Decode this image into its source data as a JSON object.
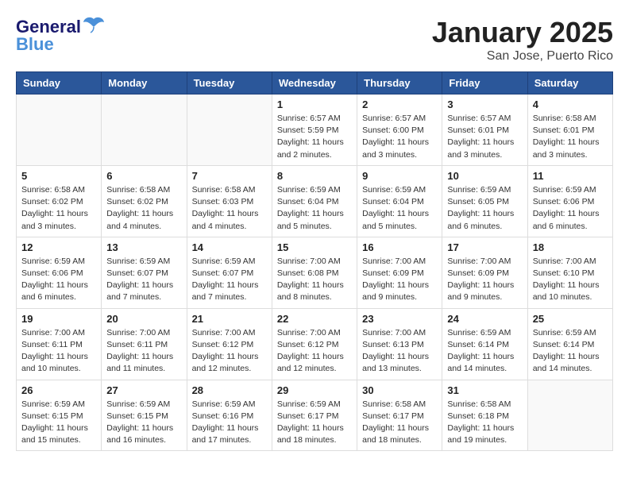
{
  "header": {
    "logo_line1": "General",
    "logo_line2": "Blue",
    "month": "January 2025",
    "location": "San Jose, Puerto Rico"
  },
  "weekdays": [
    "Sunday",
    "Monday",
    "Tuesday",
    "Wednesday",
    "Thursday",
    "Friday",
    "Saturday"
  ],
  "weeks": [
    [
      {
        "day": "",
        "info": ""
      },
      {
        "day": "",
        "info": ""
      },
      {
        "day": "",
        "info": ""
      },
      {
        "day": "1",
        "info": "Sunrise: 6:57 AM\nSunset: 5:59 PM\nDaylight: 11 hours and 2 minutes."
      },
      {
        "day": "2",
        "info": "Sunrise: 6:57 AM\nSunset: 6:00 PM\nDaylight: 11 hours and 3 minutes."
      },
      {
        "day": "3",
        "info": "Sunrise: 6:57 AM\nSunset: 6:01 PM\nDaylight: 11 hours and 3 minutes."
      },
      {
        "day": "4",
        "info": "Sunrise: 6:58 AM\nSunset: 6:01 PM\nDaylight: 11 hours and 3 minutes."
      }
    ],
    [
      {
        "day": "5",
        "info": "Sunrise: 6:58 AM\nSunset: 6:02 PM\nDaylight: 11 hours and 3 minutes."
      },
      {
        "day": "6",
        "info": "Sunrise: 6:58 AM\nSunset: 6:02 PM\nDaylight: 11 hours and 4 minutes."
      },
      {
        "day": "7",
        "info": "Sunrise: 6:58 AM\nSunset: 6:03 PM\nDaylight: 11 hours and 4 minutes."
      },
      {
        "day": "8",
        "info": "Sunrise: 6:59 AM\nSunset: 6:04 PM\nDaylight: 11 hours and 5 minutes."
      },
      {
        "day": "9",
        "info": "Sunrise: 6:59 AM\nSunset: 6:04 PM\nDaylight: 11 hours and 5 minutes."
      },
      {
        "day": "10",
        "info": "Sunrise: 6:59 AM\nSunset: 6:05 PM\nDaylight: 11 hours and 6 minutes."
      },
      {
        "day": "11",
        "info": "Sunrise: 6:59 AM\nSunset: 6:06 PM\nDaylight: 11 hours and 6 minutes."
      }
    ],
    [
      {
        "day": "12",
        "info": "Sunrise: 6:59 AM\nSunset: 6:06 PM\nDaylight: 11 hours and 6 minutes."
      },
      {
        "day": "13",
        "info": "Sunrise: 6:59 AM\nSunset: 6:07 PM\nDaylight: 11 hours and 7 minutes."
      },
      {
        "day": "14",
        "info": "Sunrise: 6:59 AM\nSunset: 6:07 PM\nDaylight: 11 hours and 7 minutes."
      },
      {
        "day": "15",
        "info": "Sunrise: 7:00 AM\nSunset: 6:08 PM\nDaylight: 11 hours and 8 minutes."
      },
      {
        "day": "16",
        "info": "Sunrise: 7:00 AM\nSunset: 6:09 PM\nDaylight: 11 hours and 9 minutes."
      },
      {
        "day": "17",
        "info": "Sunrise: 7:00 AM\nSunset: 6:09 PM\nDaylight: 11 hours and 9 minutes."
      },
      {
        "day": "18",
        "info": "Sunrise: 7:00 AM\nSunset: 6:10 PM\nDaylight: 11 hours and 10 minutes."
      }
    ],
    [
      {
        "day": "19",
        "info": "Sunrise: 7:00 AM\nSunset: 6:11 PM\nDaylight: 11 hours and 10 minutes."
      },
      {
        "day": "20",
        "info": "Sunrise: 7:00 AM\nSunset: 6:11 PM\nDaylight: 11 hours and 11 minutes."
      },
      {
        "day": "21",
        "info": "Sunrise: 7:00 AM\nSunset: 6:12 PM\nDaylight: 11 hours and 12 minutes."
      },
      {
        "day": "22",
        "info": "Sunrise: 7:00 AM\nSunset: 6:12 PM\nDaylight: 11 hours and 12 minutes."
      },
      {
        "day": "23",
        "info": "Sunrise: 7:00 AM\nSunset: 6:13 PM\nDaylight: 11 hours and 13 minutes."
      },
      {
        "day": "24",
        "info": "Sunrise: 6:59 AM\nSunset: 6:14 PM\nDaylight: 11 hours and 14 minutes."
      },
      {
        "day": "25",
        "info": "Sunrise: 6:59 AM\nSunset: 6:14 PM\nDaylight: 11 hours and 14 minutes."
      }
    ],
    [
      {
        "day": "26",
        "info": "Sunrise: 6:59 AM\nSunset: 6:15 PM\nDaylight: 11 hours and 15 minutes."
      },
      {
        "day": "27",
        "info": "Sunrise: 6:59 AM\nSunset: 6:15 PM\nDaylight: 11 hours and 16 minutes."
      },
      {
        "day": "28",
        "info": "Sunrise: 6:59 AM\nSunset: 6:16 PM\nDaylight: 11 hours and 17 minutes."
      },
      {
        "day": "29",
        "info": "Sunrise: 6:59 AM\nSunset: 6:17 PM\nDaylight: 11 hours and 18 minutes."
      },
      {
        "day": "30",
        "info": "Sunrise: 6:58 AM\nSunset: 6:17 PM\nDaylight: 11 hours and 18 minutes."
      },
      {
        "day": "31",
        "info": "Sunrise: 6:58 AM\nSunset: 6:18 PM\nDaylight: 11 hours and 19 minutes."
      },
      {
        "day": "",
        "info": ""
      }
    ]
  ]
}
